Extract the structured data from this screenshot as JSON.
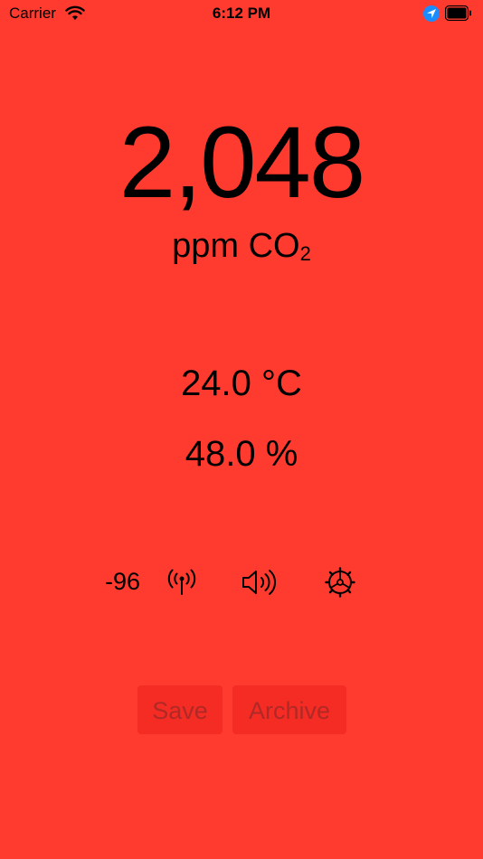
{
  "status_bar": {
    "carrier": "Carrier",
    "time": "6:12 PM"
  },
  "co2": {
    "value": "2,048",
    "unit_main": "ppm CO",
    "unit_sub": "2"
  },
  "temperature": {
    "value": "24.0",
    "unit": "°C"
  },
  "humidity": {
    "value": "48.0",
    "unit": "%"
  },
  "controls": {
    "rssi": "-96",
    "icons": [
      "antenna-icon",
      "speaker-icon",
      "gear-icon"
    ]
  },
  "buttons": {
    "save": "Save",
    "archive": "Archive"
  },
  "colors": {
    "background": "#ff3b30",
    "location_accent": "#1a8cff"
  }
}
